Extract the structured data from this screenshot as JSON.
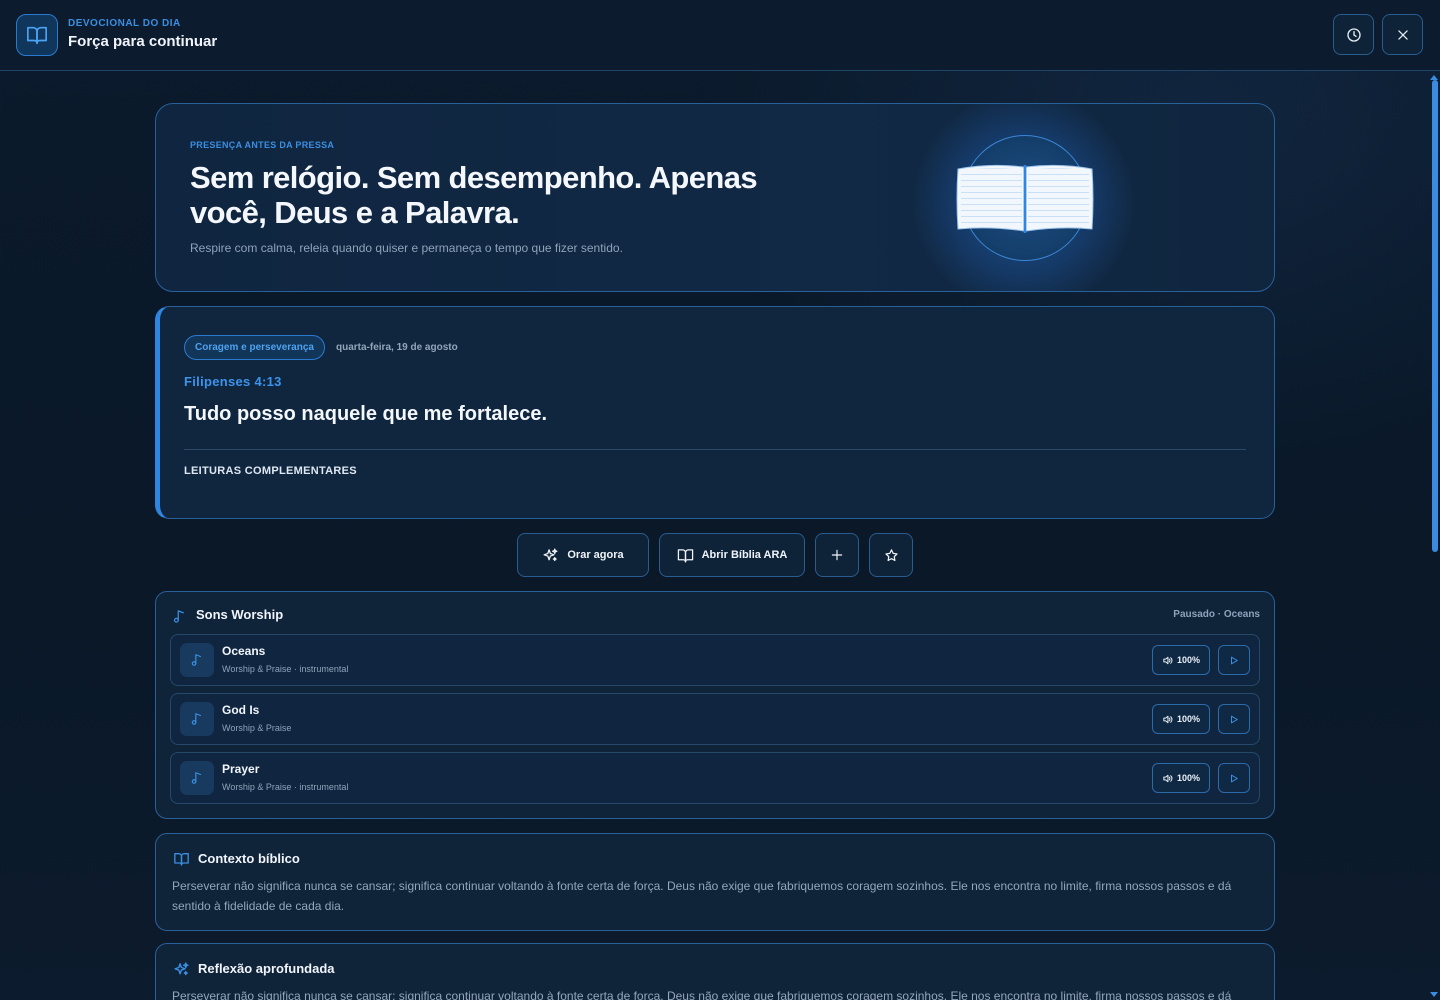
{
  "header": {
    "kicker": "DEVOCIONAL DO DIA",
    "title": "Força para continuar",
    "icons": [
      "book-icon",
      "clock-icon",
      "close-icon"
    ]
  },
  "hero": {
    "kicker": "PRESENÇA ANTES DA PRESSA",
    "title": "Sem relógio. Sem desempenho. Apenas você, Deus e a Palavra.",
    "subtitle": "Respire com calma, releia quando quiser e permaneça o tempo que fizer sentido."
  },
  "verse": {
    "tag": "Coragem e perseverança",
    "date": "quarta-feira, 19 de agosto",
    "reference": "Filipenses 4:13",
    "text": "Tudo posso naquele que me fortalece.",
    "readings_label": "LEITURAS COMPLEMENTARES"
  },
  "actions": {
    "pray_label": "Orar agora",
    "bible_label": "Abrir Bíblia ARA"
  },
  "sounds": {
    "title": "Sons Worship",
    "status": "Pausado · Oceans",
    "tracks": [
      {
        "name": "Oceans",
        "meta": "Worship & Praise · instrumental",
        "volume": "100%"
      },
      {
        "name": "God Is",
        "meta": "Worship & Praise",
        "volume": "100%"
      },
      {
        "name": "Prayer",
        "meta": "Worship & Praise · instrumental",
        "volume": "100%"
      }
    ]
  },
  "context": {
    "title": "Contexto bíblico",
    "text": "Perseverar não significa nunca se cansar; significa continuar voltando à fonte certa de força. Deus não exige que fabriquemos coragem sozinhos. Ele nos encontra no limite, firma nossos passos e dá sentido à fidelidade de cada dia."
  },
  "reflection": {
    "title": "Reflexão aprofundada",
    "text": "Perseverar não significa nunca se cansar; significa continuar voltando à fonte certa de força. Deus não exige que fabriquemos coragem sozinhos. Ele nos encontra no limite, firma nossos passos e dá sentido à fidelidade de cada dia."
  },
  "colors": {
    "accent": "#2f86e0",
    "background": "#0b1a2c",
    "card": "#10263f"
  }
}
